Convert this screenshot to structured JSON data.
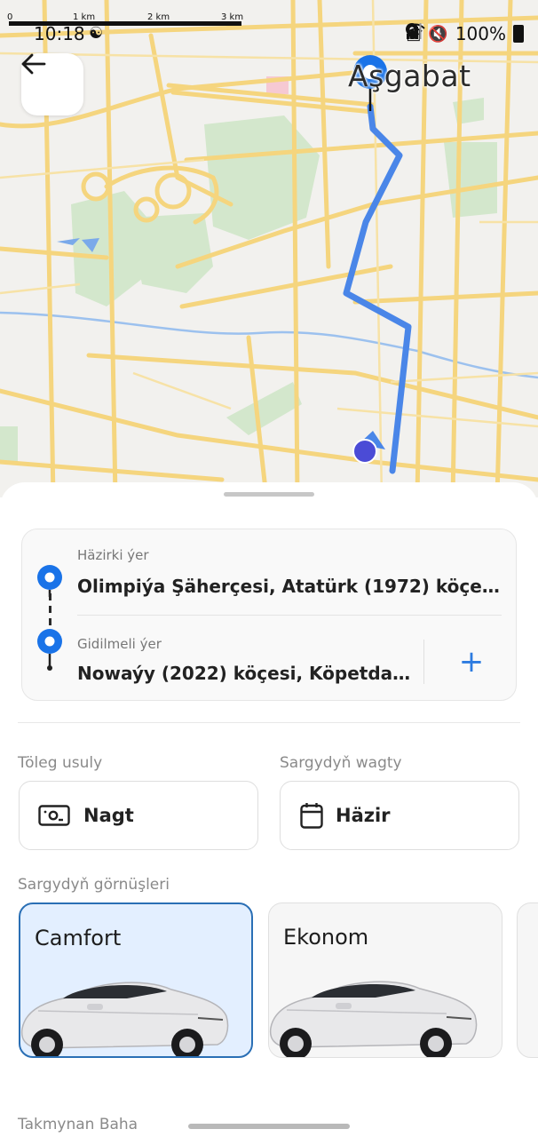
{
  "status_bar": {
    "time": "10:18",
    "battery": "100%",
    "icons": [
      "activity-icon",
      "sim-icon",
      "mute-icon",
      "location-icon",
      "wifi-icon",
      "signal-icon",
      "battery-icon"
    ]
  },
  "map": {
    "scale": {
      "labels": [
        "0",
        "1 km",
        "2 km",
        "3 km"
      ]
    },
    "city_label": "Aşgabat",
    "colors": {
      "background": "#f2f1ee",
      "road": "#f5d57e",
      "park": "#d3e7cc",
      "water": "#9cc1ee",
      "route": "#4a86e8",
      "pin": "#1a73e8"
    }
  },
  "back_button": {
    "icon": "back-arrow-icon"
  },
  "route": {
    "from": {
      "label": "Häzirki ýer",
      "value": "Olimpiýa Şäherçesi, Atatürk (1972) köçesi..."
    },
    "to": {
      "label": "Gidilmeli ýer",
      "value": "Nowaýy (2022) köçesi, Köpetdag ..."
    },
    "add_stop_icon": "+"
  },
  "payment": {
    "label": "Töleg usuly",
    "value": "Nagt",
    "icon": "cash-icon"
  },
  "order_time": {
    "label": "Sargydyň wagty",
    "value": "Häzir",
    "icon": "calendar-icon"
  },
  "order_types": {
    "label": "Sargydyň görnüşleri",
    "items": [
      {
        "name": "Camfort",
        "selected": true
      },
      {
        "name": "Ekonom",
        "selected": false
      }
    ]
  },
  "estimate": {
    "label": "Takmynan Baha"
  }
}
